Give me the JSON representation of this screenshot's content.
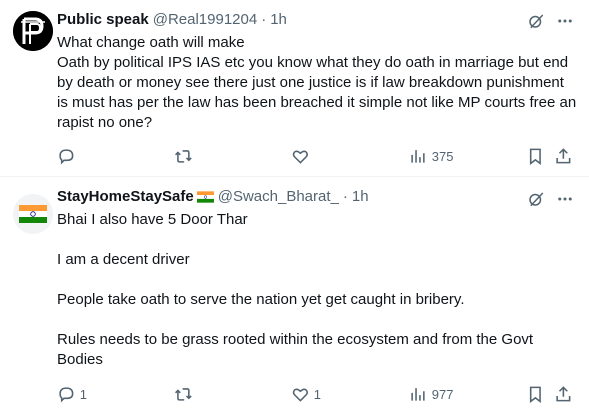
{
  "posts": [
    {
      "author_name": "Public speak",
      "handle": "@Real1991204",
      "separator": "·",
      "time": "1h",
      "text_lines": [
        "What change oath will make",
        "Oath by political IPS IAS etc you know what they do oath in marriage but end by death or money see there just one justice is  if law breakdown punishment is must has per the law has been breached it simple not like MP courts free an rapist no one?"
      ],
      "replies": "",
      "reposts": "",
      "likes": "",
      "views": "375"
    },
    {
      "author_name": "StayHomeStaySafe",
      "handle": "@Swach_Bharat_",
      "separator": "·",
      "time": "1h",
      "text_lines": [
        "Bhai I also have 5 Door Thar",
        "I am a decent driver",
        "People take oath to serve the nation yet get caught in bribery.",
        "Rules needs to be grass rooted within the ecosystem and from the Govt Bodies"
      ],
      "replies": "1",
      "reposts": "",
      "likes": "1",
      "views": "977"
    }
  ],
  "colors": {
    "text": "#0f1419",
    "secondary": "#536471",
    "divider": "#eff3f4"
  },
  "icons": [
    "reply-icon",
    "repost-icon",
    "like-icon",
    "views-icon",
    "bookmark-icon",
    "share-icon",
    "grok-icon",
    "more-icon"
  ]
}
